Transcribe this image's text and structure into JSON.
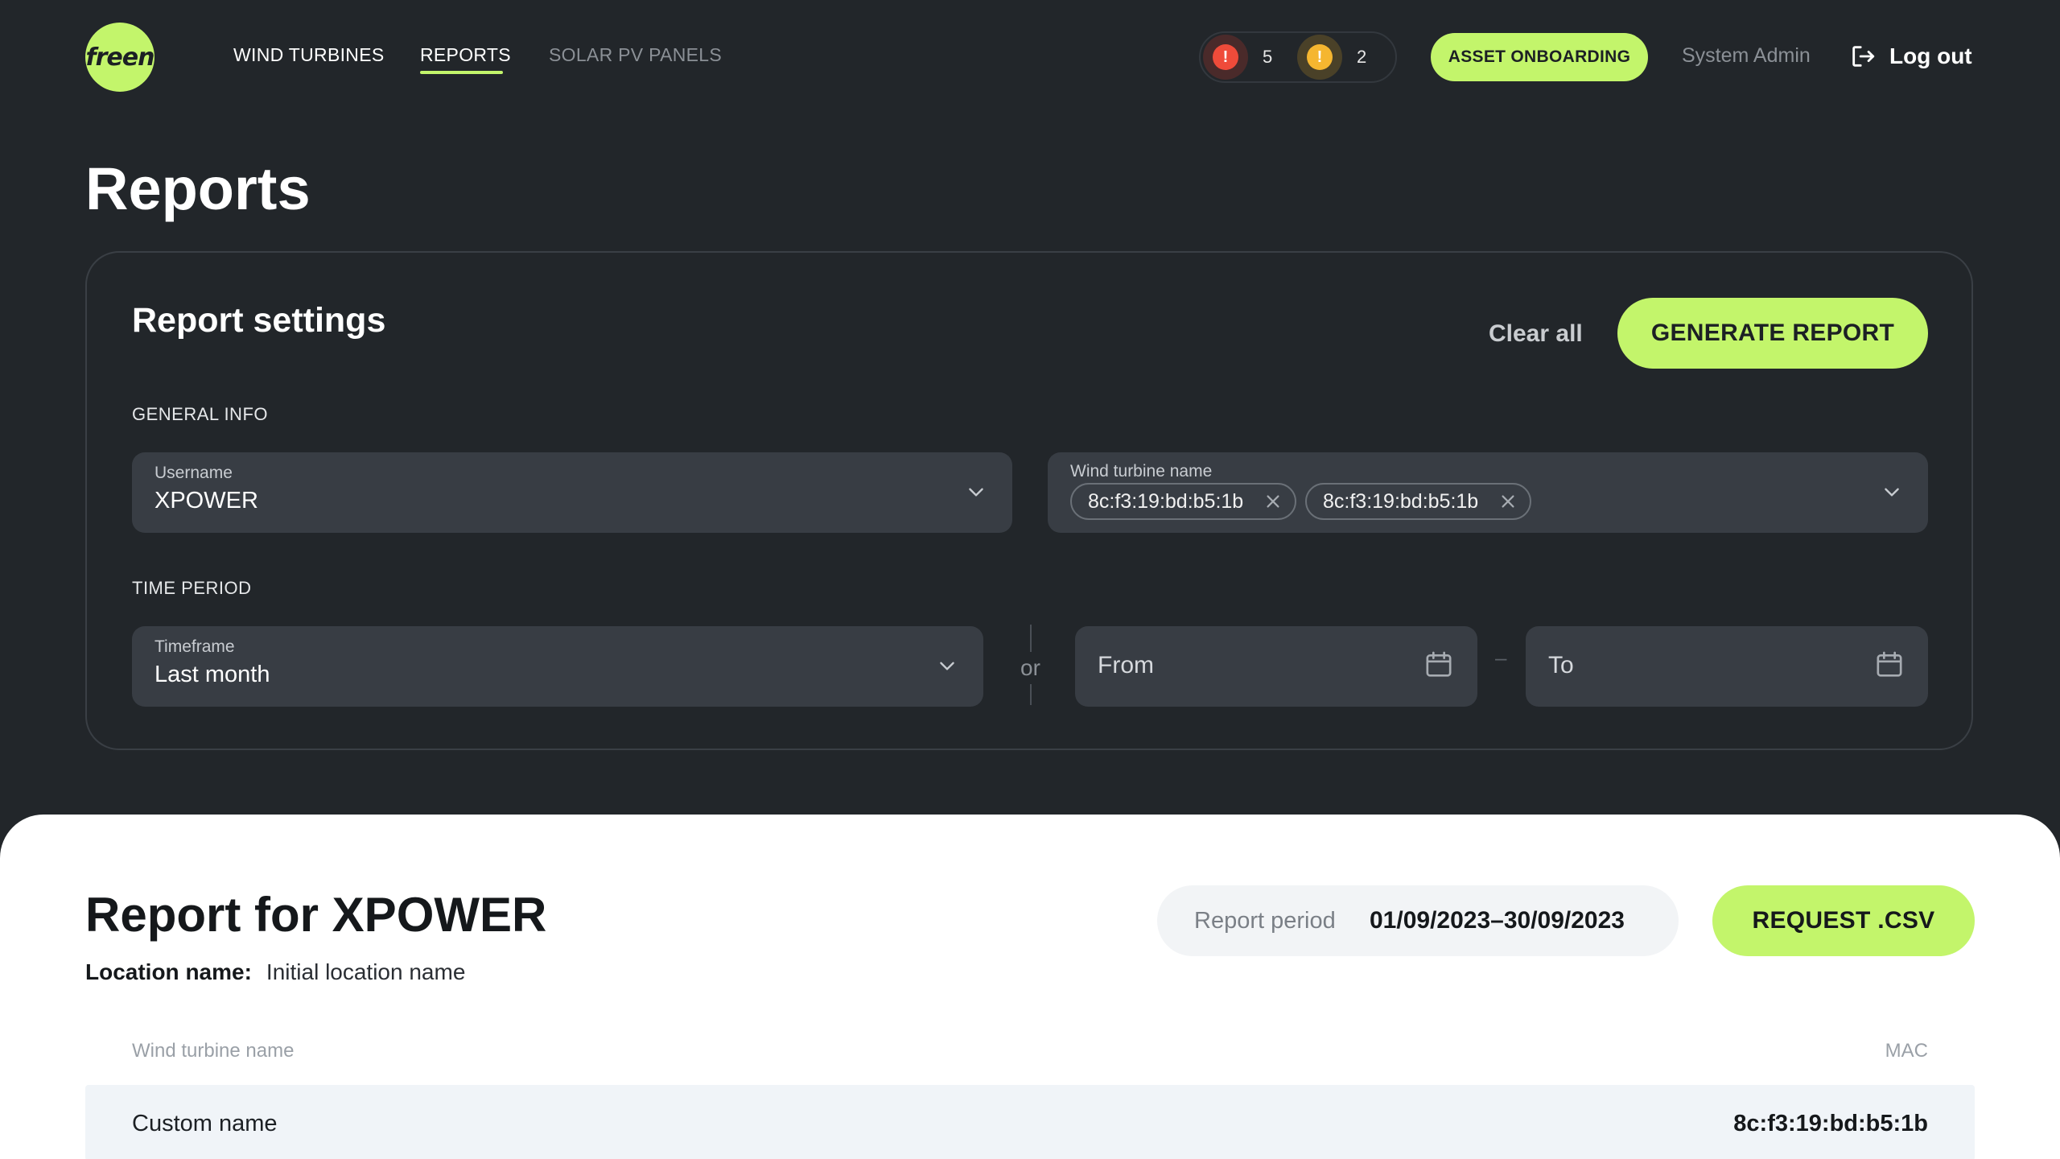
{
  "brand": {
    "logo_text": "freen",
    "accent": "#c3f56b"
  },
  "nav": {
    "items": [
      {
        "label": "WIND TURBINES"
      },
      {
        "label": "REPORTS",
        "active": true
      },
      {
        "label": "SOLAR PV PANELS"
      }
    ]
  },
  "alerts": {
    "critical": {
      "count": "5",
      "color": "#ef4b3a",
      "icon": "exclamation-icon"
    },
    "warning": {
      "count": "2",
      "color": "#f5b630",
      "icon": "exclamation-icon"
    }
  },
  "header": {
    "onboarding_label": "ASSET ONBOARDING",
    "user_name": "System Admin",
    "logout_label": "Log out"
  },
  "page": {
    "title": "Reports"
  },
  "settings": {
    "title": "Report settings",
    "clear_label": "Clear all",
    "generate_label": "GENERATE REPORT",
    "general_info_label": "GENERAL INFO",
    "username": {
      "label": "Username",
      "value": "XPOWER"
    },
    "turbine": {
      "label": "Wind turbine name",
      "tags": [
        "8c:f3:19:bd:b5:1b",
        "8c:f3:19:bd:b5:1b"
      ]
    },
    "time_period_label": "TIME PERIOD",
    "timeframe": {
      "label": "Timeframe",
      "value": "Last month"
    },
    "or_label": "or",
    "from_placeholder": "From",
    "to_placeholder": "To",
    "range_dash": "–"
  },
  "report": {
    "title": "Report for XPOWER",
    "location_label": "Location name:",
    "location_value": "Initial location name",
    "period_label": "Report period",
    "period_value": "01/09/2023–30/09/2023",
    "csv_label": "REQUEST .CSV",
    "columns": [
      "Wind turbine name",
      "MAC"
    ],
    "rows": [
      {
        "name": "Custom name",
        "mac": "8c:f3:19:bd:b5:1b"
      }
    ]
  }
}
